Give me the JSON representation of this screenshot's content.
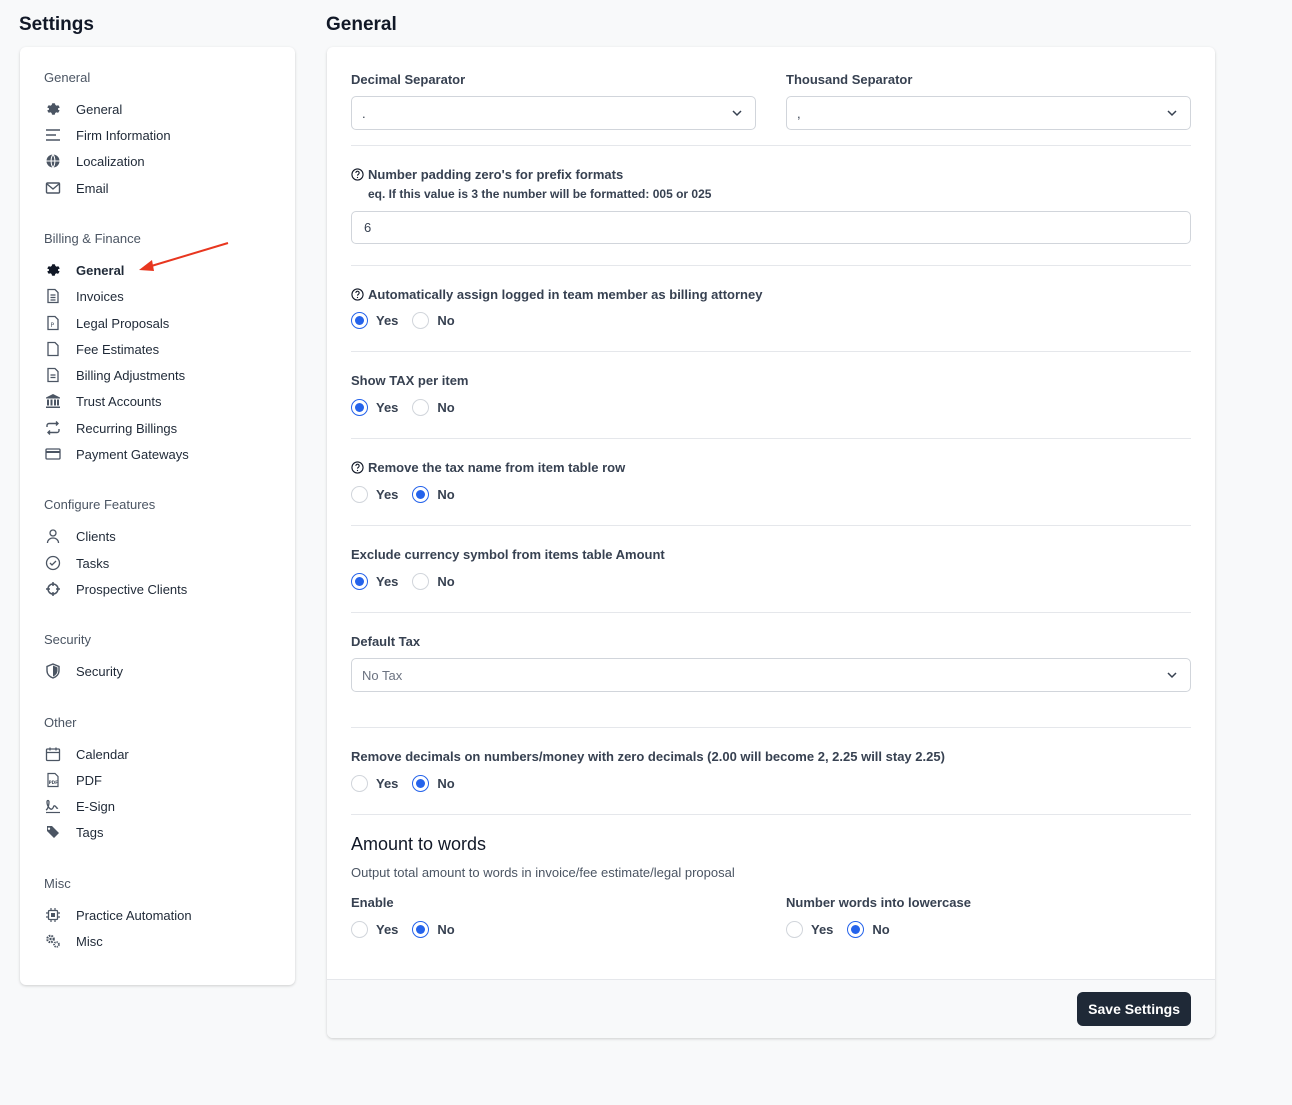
{
  "page": {
    "settings_title": "Settings",
    "content_title": "General"
  },
  "sidebar": {
    "groups": [
      {
        "title": "General",
        "items": [
          {
            "label": "General",
            "icon": "gear-icon"
          },
          {
            "label": "Firm Information",
            "icon": "bars-icon"
          },
          {
            "label": "Localization",
            "icon": "globe-icon"
          },
          {
            "label": "Email",
            "icon": "envelope-icon"
          }
        ]
      },
      {
        "title": "Billing & Finance",
        "items": [
          {
            "label": "General",
            "icon": "gear-icon",
            "active": true
          },
          {
            "label": "Invoices",
            "icon": "invoice-icon"
          },
          {
            "label": "Legal Proposals",
            "icon": "proposal-icon"
          },
          {
            "label": "Fee Estimates",
            "icon": "file-icon"
          },
          {
            "label": "Billing Adjustments",
            "icon": "file-lines-icon"
          },
          {
            "label": "Trust Accounts",
            "icon": "bank-icon"
          },
          {
            "label": "Recurring Billings",
            "icon": "repeat-icon"
          },
          {
            "label": "Payment Gateways",
            "icon": "credit-card-icon"
          }
        ]
      },
      {
        "title": "Configure Features",
        "items": [
          {
            "label": "Clients",
            "icon": "user-icon"
          },
          {
            "label": "Tasks",
            "icon": "check-circle-icon"
          },
          {
            "label": "Prospective Clients",
            "icon": "crosshairs-icon"
          }
        ]
      },
      {
        "title": "Security",
        "items": [
          {
            "label": "Security",
            "icon": "shield-icon"
          }
        ]
      },
      {
        "title": "Other",
        "items": [
          {
            "label": "Calendar",
            "icon": "calendar-icon"
          },
          {
            "label": "PDF",
            "icon": "pdf-icon"
          },
          {
            "label": "E-Sign",
            "icon": "signature-icon"
          },
          {
            "label": "Tags",
            "icon": "tags-icon"
          }
        ]
      },
      {
        "title": "Misc",
        "items": [
          {
            "label": "Practice Automation",
            "icon": "chip-icon"
          },
          {
            "label": "Misc",
            "icon": "gears-icon"
          }
        ]
      }
    ],
    "annotation": "red-arrow-icon"
  },
  "form": {
    "decimal_separator": {
      "label": "Decimal Separator",
      "value": "."
    },
    "thousand_separator": {
      "label": "Thousand Separator",
      "value": ","
    },
    "padding": {
      "label": "Number padding zero's for prefix formats",
      "hint": "eq. If this value is 3 the number will be formatted: 005 or 025",
      "value": "6"
    },
    "auto_assign": {
      "label": "Automatically assign logged in team member as billing attorney",
      "selected": "Yes"
    },
    "show_tax": {
      "label": "Show TAX per item",
      "selected": "Yes"
    },
    "remove_tax_name": {
      "label": "Remove the tax name from item table row",
      "selected": "No"
    },
    "exclude_currency": {
      "label": "Exclude currency symbol from items table Amount",
      "selected": "Yes"
    },
    "default_tax": {
      "label": "Default Tax",
      "value": "No Tax"
    },
    "remove_decimals": {
      "label": "Remove decimals on numbers/money with zero decimals (2.00 will become 2, 2.25 will stay 2.25)",
      "selected": "No"
    },
    "options": {
      "yes": "Yes",
      "no": "No"
    },
    "amount_to_words": {
      "heading": "Amount to words",
      "description": "Output total amount to words in invoice/fee estimate/legal proposal",
      "enable": {
        "label": "Enable",
        "selected": "No"
      },
      "lowercase": {
        "label": "Number words into lowercase",
        "selected": "No"
      }
    },
    "save_label": "Save Settings"
  },
  "colors": {
    "accent": "#2563eb",
    "button": "#1f2937",
    "annotation": "#e8361f"
  }
}
